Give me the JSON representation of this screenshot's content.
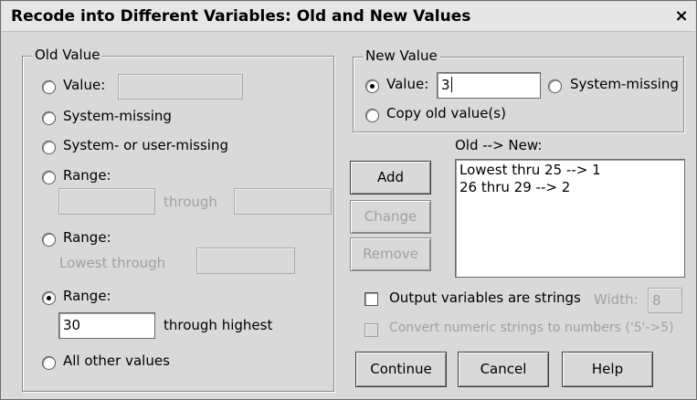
{
  "window": {
    "title": "Recode into Different Variables: Old and New Values",
    "close_glyph": "×"
  },
  "old_value": {
    "legend": "Old Value",
    "value_label": "Value:",
    "value_input": "",
    "system_missing_label": "System-missing",
    "system_or_user_missing_label": "System- or user-missing",
    "range1_label": "Range:",
    "range1_from": "",
    "range1_through": "through",
    "range1_to": "",
    "range2_label": "Range:",
    "range2_lowest_through": "Lowest through",
    "range2_value": "",
    "range3_label": "Range:",
    "range3_value": "30",
    "range3_through_highest": "through highest",
    "all_other_label": "All other values",
    "selected": "range3"
  },
  "new_value": {
    "legend": "New Value",
    "value_label": "Value:",
    "value_input": "3",
    "system_missing_label": "System-missing",
    "copy_old_label": "Copy old value(s)",
    "selected": "value"
  },
  "mapping": {
    "label": "Old --> New:",
    "items": [
      "Lowest thru 25 --> 1",
      "26 thru 29 --> 2"
    ]
  },
  "buttons": {
    "add": "Add",
    "change": "Change",
    "remove": "Remove",
    "continue": "Continue",
    "cancel": "Cancel",
    "help": "Help"
  },
  "options": {
    "output_strings_label": "Output variables are strings",
    "output_strings_checked": false,
    "width_label": "Width:",
    "width_value": "8",
    "convert_numeric_label": "Convert numeric strings to numbers ('5'->5)",
    "convert_numeric_checked": false
  }
}
